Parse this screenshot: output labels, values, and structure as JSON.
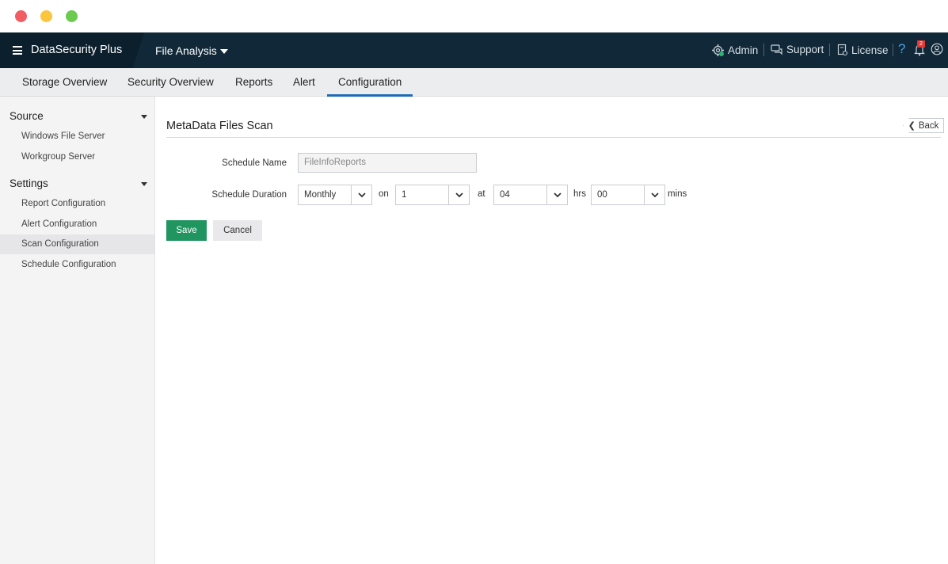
{
  "window": {
    "controls": [
      "close",
      "minimize",
      "maximize"
    ]
  },
  "header": {
    "brand": "DataSecurity Plus",
    "module": "File Analysis",
    "admin_label": "Admin",
    "support_label": "Support",
    "license_label": "License",
    "help_label": "?",
    "notification_count": "2",
    "colors": {
      "topbar": "#102838",
      "accent": "#1d6bb8",
      "save": "#219560",
      "badge": "#e53935"
    }
  },
  "nav": {
    "tabs": [
      {
        "label": "Storage Overview"
      },
      {
        "label": "Security Overview"
      },
      {
        "label": "Reports"
      },
      {
        "label": "Alert"
      },
      {
        "label": "Configuration",
        "active": true
      }
    ]
  },
  "sidebar": {
    "sections": [
      {
        "title": "Source",
        "items": [
          {
            "label": "Windows File Server"
          },
          {
            "label": "Workgroup Server"
          }
        ]
      },
      {
        "title": "Settings",
        "items": [
          {
            "label": "Report Configuration"
          },
          {
            "label": "Alert Configuration"
          },
          {
            "label": "Scan Configuration",
            "active": true
          },
          {
            "label": "Schedule Configuration"
          }
        ]
      }
    ]
  },
  "main": {
    "title": "MetaData Files Scan",
    "back_label": "Back",
    "form": {
      "schedule_name_label": "Schedule Name",
      "schedule_name_value": "FileInfoReports",
      "schedule_duration_label": "Schedule Duration",
      "frequency": "Monthly",
      "on_label": "on",
      "day": "1",
      "at_label": "at",
      "hours": "04",
      "hrs_label": "hrs",
      "minutes": "00",
      "mins_label": "mins"
    },
    "save_label": "Save",
    "cancel_label": "Cancel"
  }
}
